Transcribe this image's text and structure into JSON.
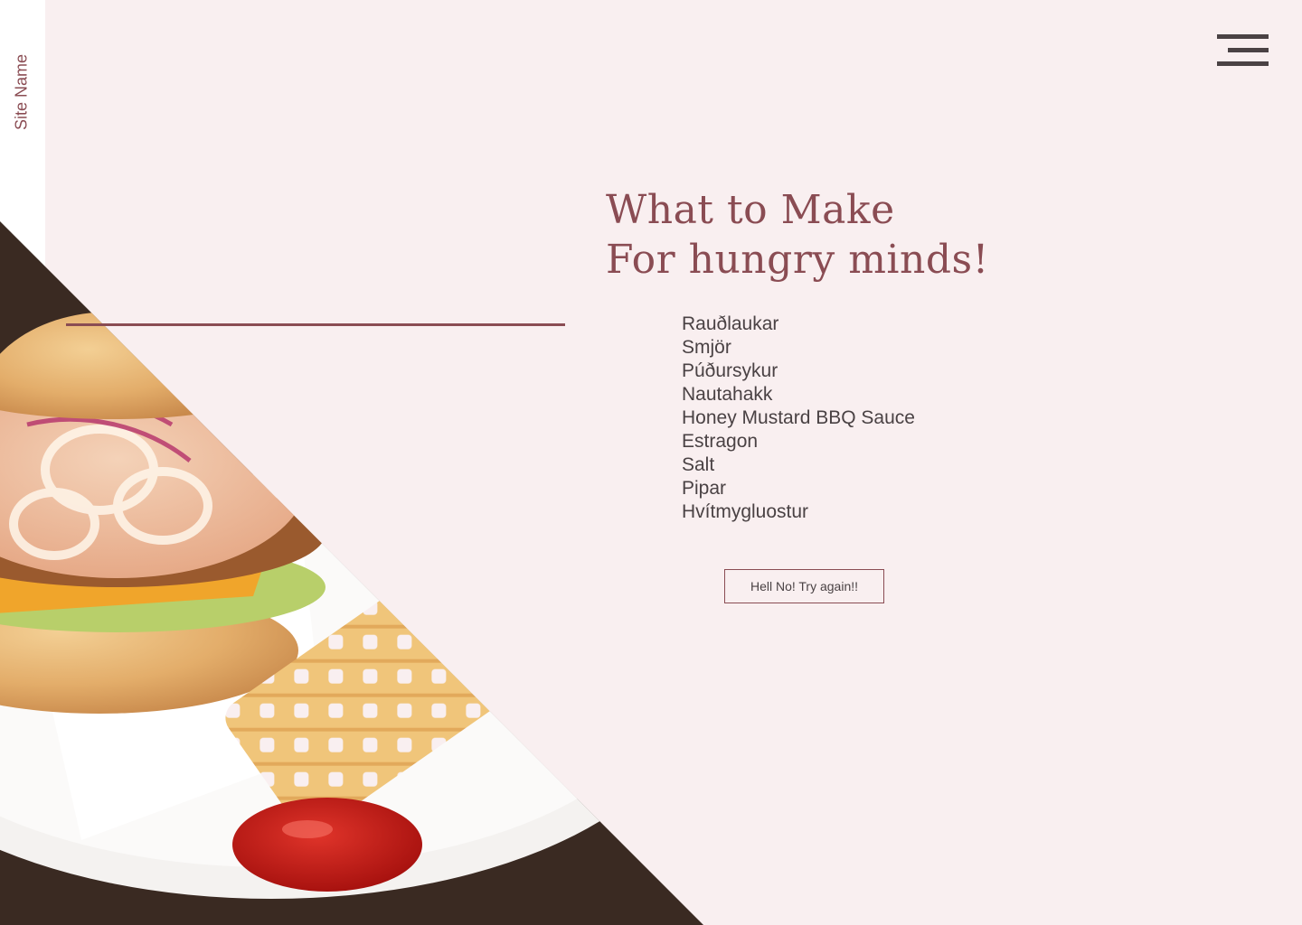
{
  "sidebar": {
    "site_name": "Site Name"
  },
  "header": {
    "menu_icon": "hamburger-menu-icon"
  },
  "main": {
    "heading_line1": "What to Make",
    "heading_line2": "For hungry minds!",
    "ingredients": [
      "Rauðlaukar",
      "Smjör",
      "Púðursykur",
      "Nautahakk",
      "Honey Mustard BBQ Sauce",
      "Estragon",
      "Salt",
      "Pipar",
      "Hvítmygluostur"
    ],
    "retry_button_label": "Hell No! Try again!!"
  },
  "colors": {
    "background": "#f9eff0",
    "accent": "#8a4c53",
    "text": "#4a4244",
    "sidebar": "#ffffff"
  }
}
